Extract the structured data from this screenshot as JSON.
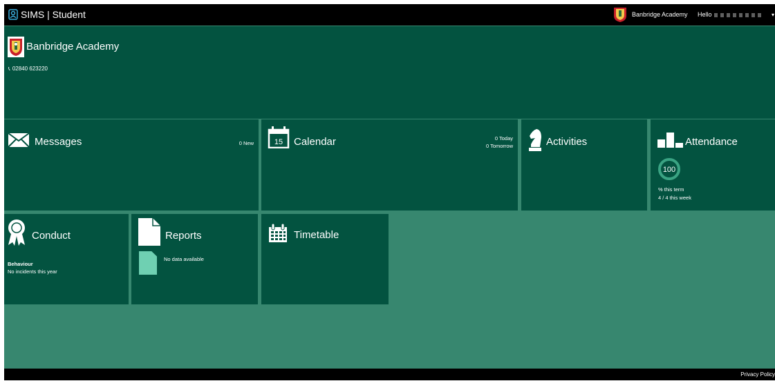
{
  "topbar": {
    "app_title": "SIMS | Student",
    "school_name": "Banbridge Academy",
    "greeting": "Hello"
  },
  "banner": {
    "school_name": "Banbridge Academy",
    "phone": "02840 623220"
  },
  "tiles": {
    "messages": {
      "title": "Messages",
      "info": "0 New",
      "icon": "envelope-icon"
    },
    "calendar": {
      "title": "Calendar",
      "info_today": "0 Today",
      "info_tomorrow": "0 Tomorrow",
      "day_number": "15",
      "icon": "calendar-icon"
    },
    "activities": {
      "title": "Activities",
      "icon": "chess-knight-icon"
    },
    "attendance": {
      "title": "Attendance",
      "value": "100",
      "term_label": "% this term",
      "week_label": "4 / 4 this week",
      "icon": "bar-chart-icon"
    },
    "conduct": {
      "title": "Conduct",
      "section": "Behaviour",
      "detail": "No incidents this year",
      "icon": "award-ribbon-icon"
    },
    "reports": {
      "title": "Reports",
      "detail": "No data available",
      "icon": "document-icon"
    },
    "timetable": {
      "title": "Timetable",
      "icon": "timetable-calendar-icon"
    }
  },
  "footer": {
    "privacy_link": "Privacy Policy"
  },
  "colors": {
    "tile": "#035340",
    "background": "#37876f",
    "accent": "#3aa383",
    "topbar": "#000000"
  }
}
